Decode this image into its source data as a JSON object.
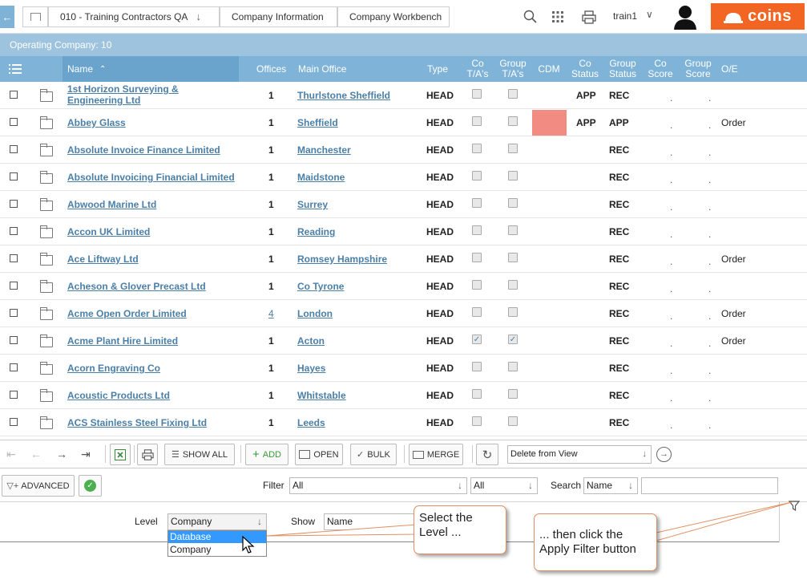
{
  "breadcrumbs": [
    "010 - Training Contractors QA",
    "Company Information",
    "Company Workbench"
  ],
  "user": {
    "name": "train1"
  },
  "logo_text": "coins",
  "operating_company": "Operating Company: 10",
  "columns": {
    "name": "Name",
    "offices": "Offices",
    "main_office": "Main Office",
    "type": "Type",
    "co_tas": "Co\nT/A's",
    "group_tas": "Group\nT/A's",
    "cdm": "CDM",
    "co_status": "Co\nStatus",
    "group_status": "Group\nStatus",
    "co_score": "Co\nScore",
    "group_score": "Group\nScore",
    "oe": "O/E"
  },
  "rows": [
    {
      "name": "1st Horizon Surveying & Engineering Ltd",
      "offices": "1",
      "main_office": "Thurlstone Sheffield",
      "type": "HEAD",
      "co_ta": false,
      "group_ta": false,
      "cdm": "",
      "co_status": "APP",
      "group_status": "REC",
      "oe": ""
    },
    {
      "name": "Abbey Glass",
      "offices": "1",
      "main_office": "Sheffield",
      "type": "HEAD",
      "co_ta": false,
      "group_ta": false,
      "cdm": "red",
      "co_status": "APP",
      "group_status": "APP",
      "oe": "Order"
    },
    {
      "name": "Absolute Invoice Finance Limited",
      "offices": "1",
      "main_office": "Manchester",
      "type": "HEAD",
      "co_ta": false,
      "group_ta": false,
      "cdm": "",
      "co_status": "",
      "group_status": "REC",
      "oe": ""
    },
    {
      "name": "Absolute Invoicing Financial Limited",
      "offices": "1",
      "main_office": "Maidstone",
      "type": "HEAD",
      "co_ta": false,
      "group_ta": false,
      "cdm": "",
      "co_status": "",
      "group_status": "REC",
      "oe": ""
    },
    {
      "name": "Abwood Marine Ltd",
      "offices": "1",
      "main_office": "Surrey",
      "type": "HEAD",
      "co_ta": false,
      "group_ta": false,
      "cdm": "",
      "co_status": "",
      "group_status": "REC",
      "oe": ""
    },
    {
      "name": "Accon UK Limited",
      "offices": "1",
      "main_office": "Reading",
      "type": "HEAD",
      "co_ta": false,
      "group_ta": false,
      "cdm": "",
      "co_status": "",
      "group_status": "REC",
      "oe": ""
    },
    {
      "name": "Ace Liftway Ltd",
      "offices": "1",
      "main_office": "Romsey Hampshire",
      "type": "HEAD",
      "co_ta": false,
      "group_ta": false,
      "cdm": "",
      "co_status": "",
      "group_status": "REC",
      "oe": "Order"
    },
    {
      "name": "Acheson & Glover Precast Ltd",
      "offices": "1",
      "main_office": "Co Tyrone",
      "type": "HEAD",
      "co_ta": false,
      "group_ta": false,
      "cdm": "",
      "co_status": "",
      "group_status": "REC",
      "oe": ""
    },
    {
      "name": "Acme Open Order Limited",
      "offices": "4",
      "main_office": "London",
      "type": "HEAD",
      "co_ta": false,
      "group_ta": false,
      "cdm": "",
      "co_status": "",
      "group_status": "REC",
      "oe": "Order"
    },
    {
      "name": "Acme Plant Hire Limited",
      "offices": "1",
      "main_office": "Acton",
      "type": "HEAD",
      "co_ta": true,
      "group_ta": true,
      "cdm": "",
      "co_status": "",
      "group_status": "REC",
      "oe": "Order"
    },
    {
      "name": "Acorn Engraving Co",
      "offices": "1",
      "main_office": "Hayes",
      "type": "HEAD",
      "co_ta": false,
      "group_ta": false,
      "cdm": "",
      "co_status": "",
      "group_status": "REC",
      "oe": ""
    },
    {
      "name": "Acoustic Products Ltd",
      "offices": "1",
      "main_office": "Whitstable",
      "type": "HEAD",
      "co_ta": false,
      "group_ta": false,
      "cdm": "",
      "co_status": "",
      "group_status": "REC",
      "oe": ""
    },
    {
      "name": "ACS Stainless Steel Fixing Ltd",
      "offices": "1",
      "main_office": "Leeds",
      "type": "HEAD",
      "co_ta": false,
      "group_ta": false,
      "cdm": "",
      "co_status": "",
      "group_status": "REC",
      "oe": ""
    }
  ],
  "toolbar": {
    "show_all": "SHOW ALL",
    "add": "ADD",
    "open": "OPEN",
    "bulk": "BULK",
    "merge": "MERGE",
    "action_select": "Delete from View"
  },
  "filter": {
    "advanced": "ADVANCED",
    "filter_label": "Filter",
    "filter_value": "All",
    "filter_value2": "All",
    "search_label": "Search",
    "search_field": "Name",
    "search_value": ""
  },
  "level": {
    "label": "Level",
    "value": "Company",
    "options": [
      "Database",
      "Company"
    ],
    "show_label": "Show",
    "show_value": "Name"
  },
  "callouts": {
    "select_level": "Select the Level ...",
    "apply_filter": "... then click the Apply Filter button"
  },
  "colors": {
    "header": "#7fb4d8",
    "opbar": "#9dc3de",
    "link": "#4a7fa8",
    "logo": "#f26522",
    "cdm_red": "#f28b82",
    "callout_border": "#e09060"
  }
}
